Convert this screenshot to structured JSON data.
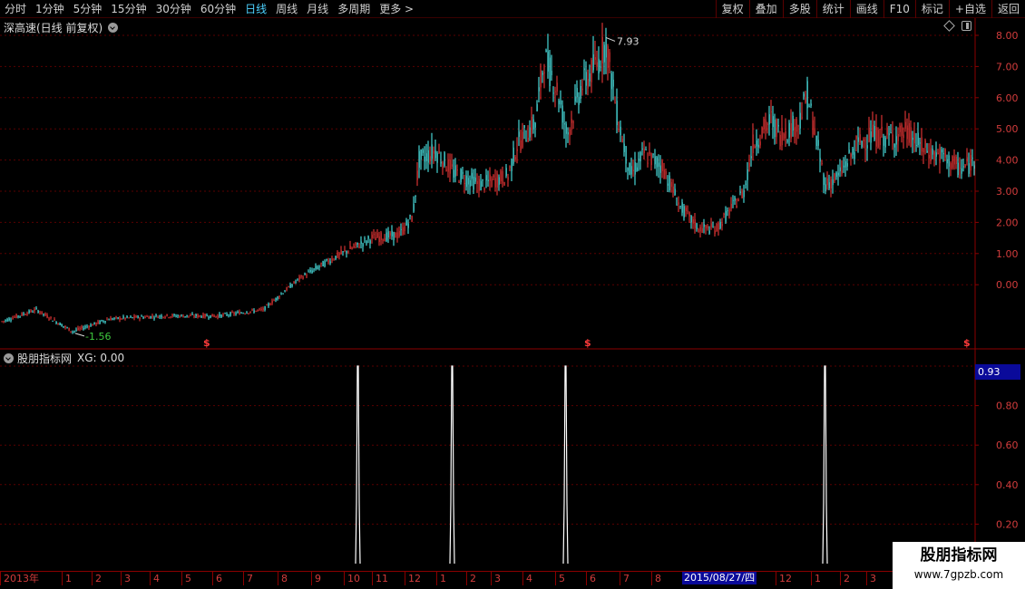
{
  "toolbar": {
    "periods": [
      "分时",
      "1分钟",
      "5分钟",
      "15分钟",
      "30分钟",
      "60分钟",
      "日线",
      "周线",
      "月线",
      "多周期",
      "更多 >"
    ],
    "active_period": "日线",
    "tools": [
      "复权",
      "叠加",
      "多股",
      "统计",
      "画线",
      "F10",
      "标记",
      "+自选",
      "返回"
    ]
  },
  "main_chart": {
    "title": "深高速(日线 前复权)",
    "high_label": "7.93",
    "low_label": "-1.56",
    "marker_symbol": "$",
    "colors": {
      "up": "#ff3b3b",
      "down": "#54ffff",
      "high_label": "#dcdcdc",
      "low_label": "#3ec93e"
    }
  },
  "indicator": {
    "title": "股朋指标网",
    "xg_label": "XG: 0.00",
    "current_value": "0.93",
    "icon": "chevron-circle-icon"
  },
  "time_axis": {
    "labels": [
      "2013年",
      "1",
      "2",
      "3",
      "4",
      "5",
      "6",
      "7",
      "8",
      "9",
      "10",
      "11",
      "12",
      "1",
      "2",
      "3",
      "4",
      "5",
      "6",
      "7",
      "8",
      "12",
      "1",
      "2",
      "3"
    ],
    "cursor_date": "2015/08/27/四"
  },
  "watermark": {
    "title": "股朋指标网",
    "url": "www.7gpzb.com"
  },
  "chart_data": [
    {
      "type": "candlestick",
      "title": "深高速(日线 前复权)",
      "y_ticks": [
        "8.00",
        "7.00",
        "6.00",
        "5.00",
        "4.00",
        "3.00",
        "2.00",
        "1.00",
        "0.00"
      ],
      "ylim": [
        -1.6,
        8.3
      ],
      "annotations": {
        "max": 7.93,
        "min": -1.56
      },
      "approx_close_path": [
        [
          0,
          -1.2
        ],
        [
          40,
          -0.8
        ],
        [
          80,
          -1.5
        ],
        [
          120,
          -1.1
        ],
        [
          180,
          -1.0
        ],
        [
          240,
          -1.0
        ],
        [
          290,
          -0.8
        ],
        [
          330,
          0.2
        ],
        [
          370,
          0.9
        ],
        [
          410,
          1.5
        ],
        [
          440,
          1.6
        ],
        [
          455,
          2.2
        ],
        [
          462,
          4.0
        ],
        [
          480,
          4.3
        ],
        [
          500,
          3.6
        ],
        [
          530,
          3.2
        ],
        [
          560,
          3.5
        ],
        [
          570,
          4.5
        ],
        [
          590,
          5.2
        ],
        [
          600,
          7.3
        ],
        [
          615,
          6.2
        ],
        [
          625,
          4.8
        ],
        [
          640,
          6.3
        ],
        [
          660,
          7.2
        ],
        [
          668,
          7.8
        ],
        [
          680,
          5.5
        ],
        [
          695,
          3.5
        ],
        [
          710,
          4.2
        ],
        [
          730,
          3.8
        ],
        [
          750,
          2.5
        ],
        [
          770,
          1.8
        ],
        [
          790,
          1.8
        ],
        [
          820,
          3.0
        ],
        [
          830,
          4.5
        ],
        [
          850,
          5.3
        ],
        [
          860,
          4.8
        ],
        [
          880,
          5.2
        ],
        [
          890,
          6.1
        ],
        [
          900,
          4.6
        ],
        [
          910,
          3.2
        ],
        [
          925,
          3.5
        ],
        [
          945,
          4.5
        ],
        [
          960,
          4.8
        ],
        [
          980,
          4.7
        ],
        [
          1000,
          4.9
        ],
        [
          1020,
          4.3
        ],
        [
          1040,
          4.1
        ],
        [
          1060,
          3.7
        ],
        [
          1075,
          4.0
        ]
      ]
    },
    {
      "type": "line",
      "title": "股朋指标网",
      "y_ticks": [
        "1.00",
        "0.80",
        "0.60",
        "0.40",
        "0.20"
      ],
      "ylim": [
        0,
        1.0
      ],
      "signal_x": [
        394,
        498,
        623,
        909
      ],
      "signal_value": 1.0
    }
  ]
}
